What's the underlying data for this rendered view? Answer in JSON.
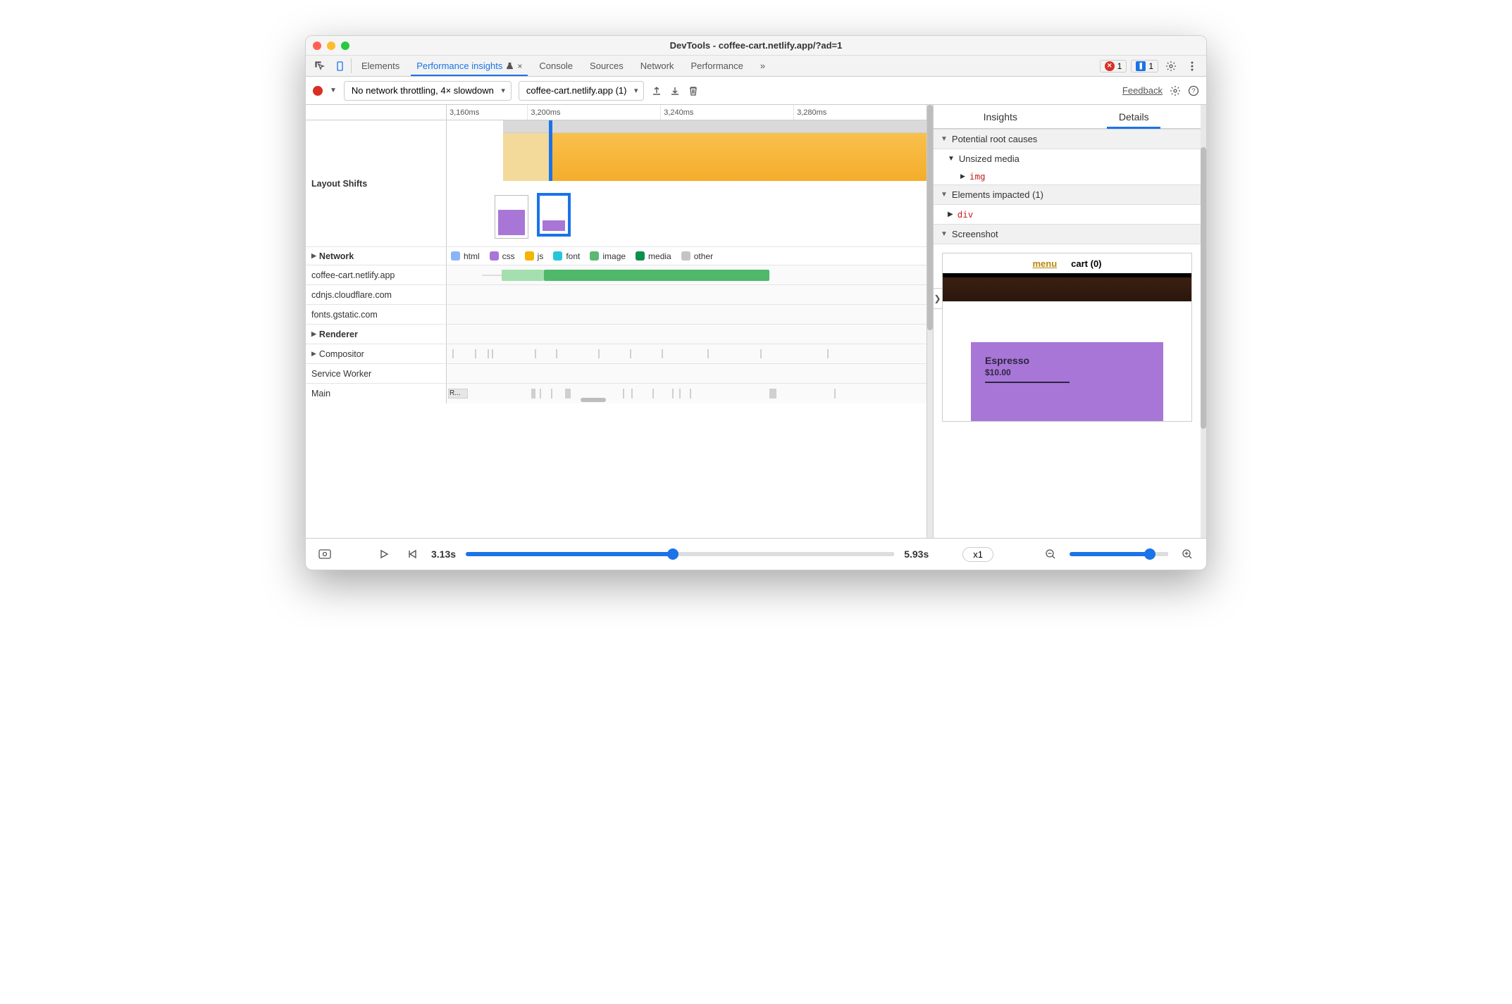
{
  "window": {
    "title": "DevTools - coffee-cart.netlify.app/?ad=1"
  },
  "tabs": {
    "items": [
      "Elements",
      "Performance insights",
      "Console",
      "Sources",
      "Network",
      "Performance"
    ],
    "activeIndex": 1,
    "errorCount": "1",
    "messageCount": "1"
  },
  "toolbar": {
    "throttling": "No network throttling, 4× slowdown",
    "origin": "coffee-cart.netlify.app (1)",
    "feedback": "Feedback"
  },
  "ruler": [
    "3,160ms",
    "3,200ms",
    "3,240ms",
    "3,280ms"
  ],
  "trackLabels": {
    "layoutShifts": "Layout Shifts",
    "network": "Network",
    "renderer": "Renderer",
    "compositor": "Compositor",
    "serviceWorker": "Service Worker",
    "main": "Main"
  },
  "legend": [
    {
      "label": "html",
      "color": "#8ab4f8"
    },
    {
      "label": "css",
      "color": "#a876d6"
    },
    {
      "label": "js",
      "color": "#f4b400"
    },
    {
      "label": "font",
      "color": "#26c6da"
    },
    {
      "label": "image",
      "color": "#5bb974"
    },
    {
      "label": "media",
      "color": "#0d904f"
    },
    {
      "label": "other",
      "color": "#c4c4c4"
    }
  ],
  "networkHosts": [
    "coffee-cart.netlify.app",
    "cdnjs.cloudflare.com",
    "fonts.gstatic.com"
  ],
  "rightPanel": {
    "tabs": [
      "Insights",
      "Details"
    ],
    "activeIndex": 1,
    "rootCauses": "Potential root causes",
    "unsized": "Unsized media",
    "unsizedTag": "img",
    "impacted": "Elements impacted (1)",
    "impactedTag": "div",
    "screenshot": "Screenshot",
    "preview": {
      "menu": "menu",
      "cart": "cart (0)",
      "item": "Espresso",
      "price": "$10.00"
    }
  },
  "footer": {
    "t0": "3.13s",
    "t1": "5.93s",
    "speed": "x1"
  },
  "mainMarkLabel": "R..."
}
